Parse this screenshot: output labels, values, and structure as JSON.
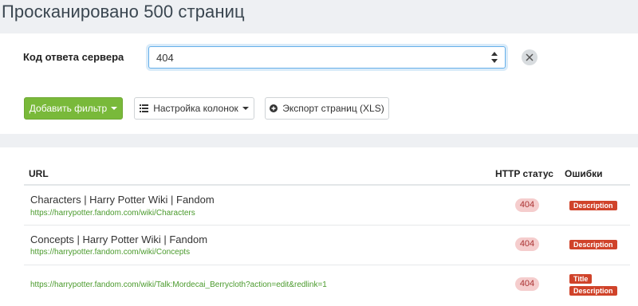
{
  "page": {
    "title": "Просканировано 500 страниц"
  },
  "filter": {
    "label": "Код ответа сервера",
    "value": "404"
  },
  "toolbar": {
    "add_filter_label": "Добавить фильтр",
    "columns_label": "Настройка колонок",
    "export_label": "Экспорт страниц (XLS)"
  },
  "table": {
    "columns": [
      "URL",
      "HTTP статус",
      "Ошибки"
    ],
    "rows": [
      {
        "title": "Characters | Harry Potter Wiki | Fandom",
        "url": "https://harrypotter.fandom.com/wiki/Characters",
        "status": "404",
        "errors": [
          "Description"
        ]
      },
      {
        "title": "Concepts | Harry Potter Wiki | Fandom",
        "url": "https://harrypotter.fandom.com/wiki/Concepts",
        "status": "404",
        "errors": [
          "Description"
        ]
      },
      {
        "title": "",
        "url": "https://harrypotter.fandom.com/wiki/Talk:Mordecai_Berrycloth?action=edit&redlink=1",
        "status": "404",
        "errors": [
          "Title",
          "Description"
        ]
      }
    ]
  },
  "colors": {
    "accent_green": "#79b93a",
    "url_green": "#4a9a2c",
    "error_red": "#d0432a",
    "status_pink": "#f5cdcd"
  },
  "icons": {
    "columns": "list-icon",
    "export": "circle-plus-icon",
    "clear": "close-icon",
    "select": "updown-arrows-icon"
  }
}
